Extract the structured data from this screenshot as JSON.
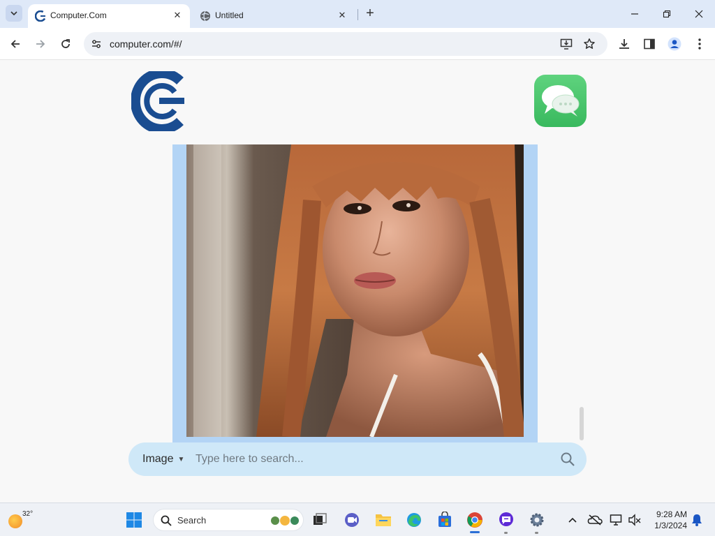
{
  "browser": {
    "tabs": [
      {
        "title": "Computer.Com",
        "active": true
      },
      {
        "title": "Untitled",
        "active": false
      }
    ],
    "address": "computer.com/#/"
  },
  "page": {
    "search": {
      "type_label": "Image",
      "placeholder": "Type here to search..."
    }
  },
  "taskbar": {
    "weather_temp": "32°",
    "search_label": "Search",
    "time": "9:28 AM",
    "date": "1/3/2024"
  },
  "colors": {
    "accent_blue": "#1a4d91",
    "frame_blue": "#b3d4f5",
    "search_bg": "#cfe8f8",
    "messages_green": "#4cc66e"
  }
}
